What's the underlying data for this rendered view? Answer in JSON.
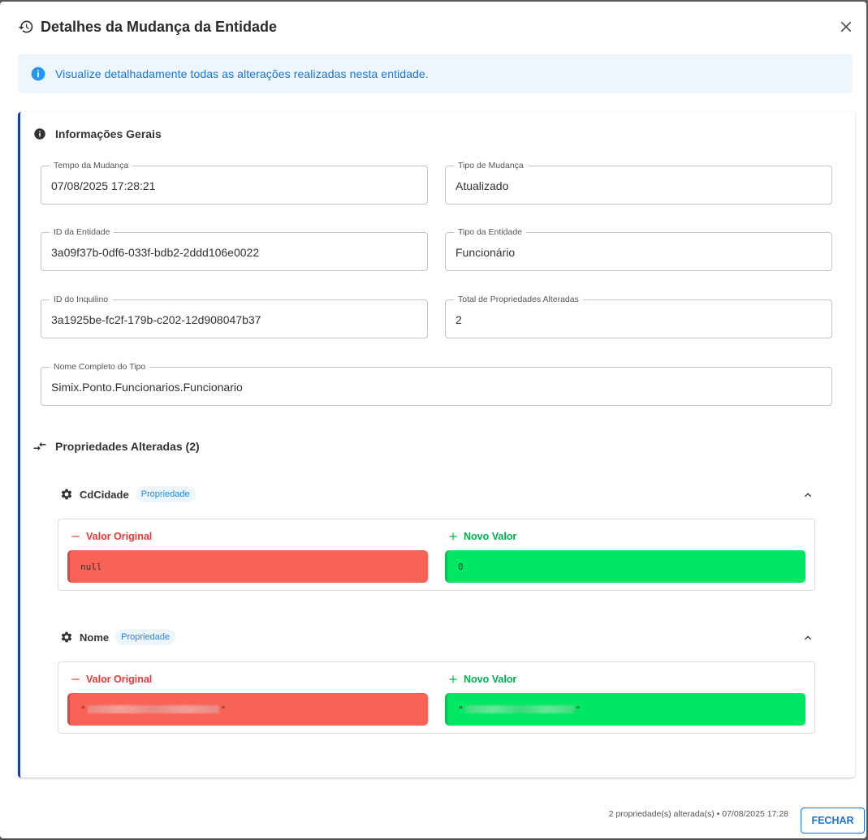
{
  "dialog": {
    "title": "Detalhes da Mudança da Entidade",
    "alert_text": "Visualize detalhadamente todas as alterações realizadas nesta entidade."
  },
  "general": {
    "section_title": "Informações Gerais",
    "fields": {
      "tempo": {
        "label": "Tempo da Mudança",
        "value": "07/08/2025 17:28:21"
      },
      "tipo_mudanca": {
        "label": "Tipo de Mudança",
        "value": "Atualizado"
      },
      "id_entidade": {
        "label": "ID da Entidade",
        "value": "3a09f37b-0df6-033f-bdb2-2ddd106e0022"
      },
      "tipo_entidade": {
        "label": "Tipo da Entidade",
        "value": "Funcionário"
      },
      "id_inquilino": {
        "label": "ID do Inquilino",
        "value": "3a1925be-fc2f-179b-c202-12d908047b37"
      },
      "total": {
        "label": "Total de Propriedades Alteradas",
        "value": "2"
      },
      "nome_tipo": {
        "label": "Nome Completo do Tipo",
        "value": "Simix.Ponto.Funcionarios.Funcionario"
      }
    }
  },
  "changes": {
    "section_title": "Propriedades Alteradas (2)",
    "original_label": "Valor Original",
    "new_label": "Novo Valor",
    "chip_label": "Propriedade",
    "properties": [
      {
        "name": "CdCidade",
        "original": "null",
        "new": "0"
      },
      {
        "name": "Nome",
        "original": "\"",
        "new": "\""
      }
    ]
  },
  "footer": {
    "summary": "2 propriedade(s) alterada(s) • 07/08/2025 17:28",
    "close_label": "FECHAR"
  },
  "colors": {
    "accent": "#1976d2",
    "original_bg": "#f96257",
    "new_bg": "#00e763",
    "card_border": "#1f3f9a"
  }
}
